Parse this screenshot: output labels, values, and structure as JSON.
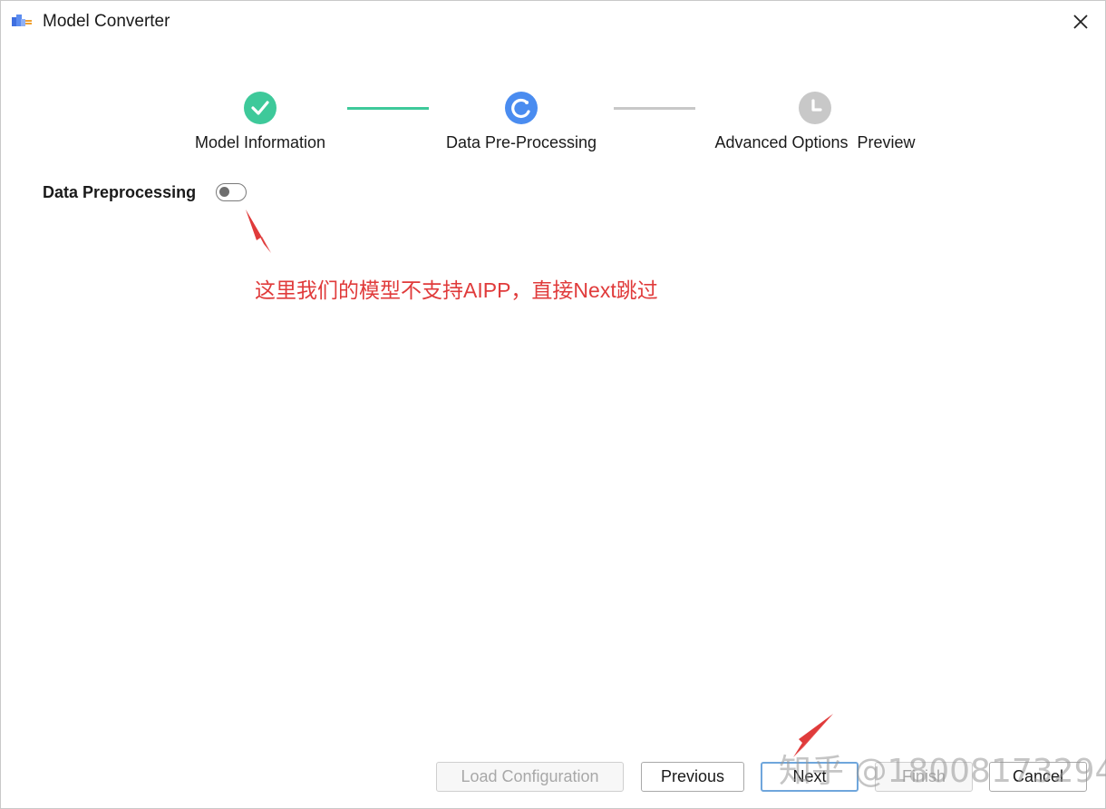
{
  "window": {
    "title": "Model Converter"
  },
  "steps": [
    {
      "label": "Model Information",
      "state": "done",
      "color": "#3ec99a"
    },
    {
      "label": "Data Pre-Processing",
      "state": "active",
      "color": "#4a8cf0"
    },
    {
      "label": "Advanced Options  Preview",
      "state": "pending",
      "color": "#c8c8c8"
    }
  ],
  "connectors": {
    "done_color": "#3ec99a",
    "pending_color": "#c8c8c8"
  },
  "preprocessing": {
    "label": "Data Preprocessing",
    "enabled": false
  },
  "annotation": {
    "text": "这里我们的模型不支持AIPP，直接Next跳过",
    "color": "#e03b3b"
  },
  "buttons": {
    "load_config": "Load Configuration",
    "previous": "Previous",
    "next": "Next",
    "finish": "Finish",
    "cancel": "Cancel"
  },
  "watermark": "知乎 @18008173294",
  "colors": {
    "accent": "#4a8cf0",
    "success": "#3ec99a",
    "annotation": "#e03b3b"
  }
}
